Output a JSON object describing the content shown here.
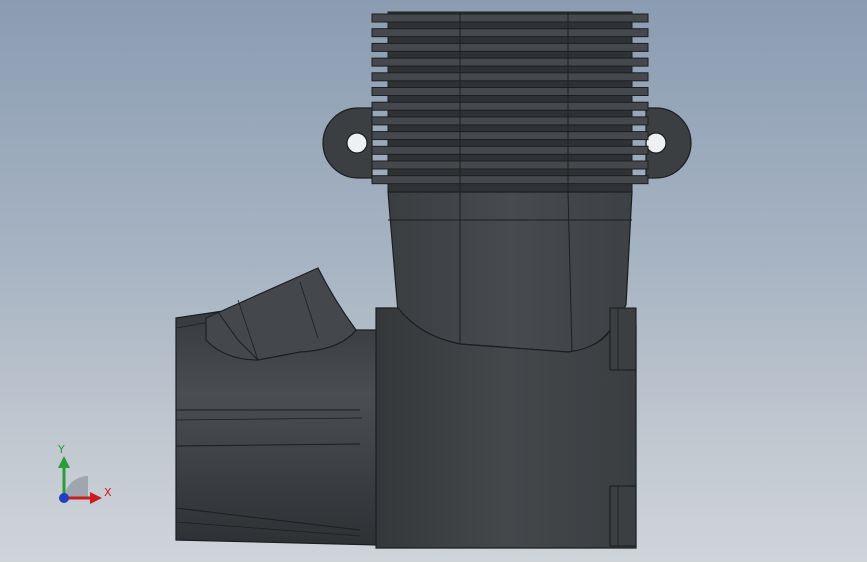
{
  "triad": {
    "x_label": "X",
    "y_label": "Y",
    "x_color": "#d02020",
    "y_color": "#20a030",
    "z_color": "#2040c0"
  },
  "model": {
    "body_color": "#3d4144",
    "edge_color": "#1c1e20",
    "highlight_color": "#5a5f63"
  }
}
